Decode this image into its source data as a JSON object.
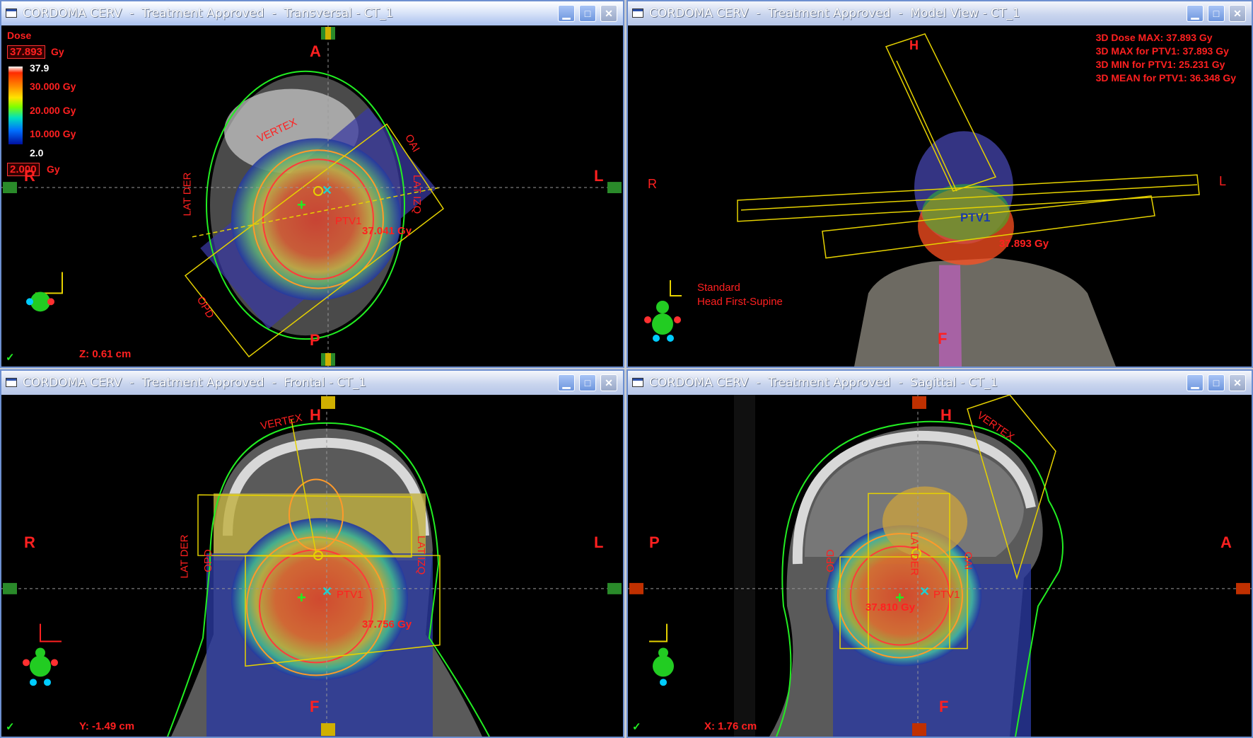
{
  "windows": {
    "transversal": {
      "title": "CORDOMA CERV  -  Treatment Approved  -  Transversal - CT_1",
      "orient_top": "A",
      "orient_bottom": "P",
      "orient_left": "R",
      "orient_right": "L",
      "legend": {
        "label": "Dose",
        "max_value": "37.893",
        "max_unit": "Gy",
        "top_tick": "37.9",
        "tick_30": "30.000 Gy",
        "tick_20": "20.000 Gy",
        "tick_10": "10.000 Gy",
        "bottom_tick": "2.0",
        "min_value": "2.000",
        "min_unit": "Gy"
      },
      "beam_labels": [
        "VERTEX",
        "OAI",
        "LAT IZQ",
        "LAT DER",
        "OPD"
      ],
      "structure_label": "PTV1",
      "dose_point": "37.041 Gy",
      "slice_position": "Z: 0.61 cm",
      "check_mark": "✓"
    },
    "model": {
      "title": "CORDOMA CERV  -  Treatment Approved  -  Model View - CT_1",
      "orient_top": "H",
      "orient_bottom": "F",
      "orient_left": "R",
      "orient_right": "L",
      "stats": [
        "3D Dose MAX: 37.893 Gy",
        "3D MAX for PTV1: 37.893 Gy",
        "3D MIN for PTV1: 25.231 Gy",
        "3D MEAN for PTV1: 36.348 Gy"
      ],
      "structure_label": "PTV1",
      "dose_point": "37.893 Gy",
      "position_line1": "Standard",
      "position_line2": "Head First-Supine"
    },
    "frontal": {
      "title": "CORDOMA CERV  -  Treatment Approved  -  Frontal - CT_1",
      "orient_top": "H",
      "orient_bottom": "F",
      "orient_left": "R",
      "orient_right": "L",
      "beam_labels": [
        "VERTEX",
        "LAT DER",
        "OPD",
        "LAT IZQ"
      ],
      "structure_label": "PTV1",
      "dose_point": "37.756 Gy",
      "slice_position": "Y: -1.49 cm",
      "check_mark": "✓"
    },
    "sagittal": {
      "title": "CORDOMA CERV  -  Treatment Approved  -  Sagittal - CT_1",
      "orient_top": "H",
      "orient_bottom": "F",
      "orient_left": "P",
      "orient_right": "A",
      "beam_labels": [
        "VERTEX",
        "OPD",
        "LAT DER",
        "OAI"
      ],
      "structure_label": "PTV1",
      "dose_point": "37.810 Gy",
      "slice_position": "X: 1.76 cm",
      "check_mark": "✓"
    }
  },
  "colors": {
    "dose_high": "#ff2a00",
    "dose_low": "#0010a0",
    "body_contour": "#22ee22",
    "beam_outline": "#e6d200",
    "label_red": "#ff2020"
  },
  "icons": {
    "window": "window-icon",
    "minimize": "minimize-icon",
    "maximize": "maximize-icon",
    "close": "close-icon",
    "patient_orientation": "patient-orientation-icon"
  }
}
